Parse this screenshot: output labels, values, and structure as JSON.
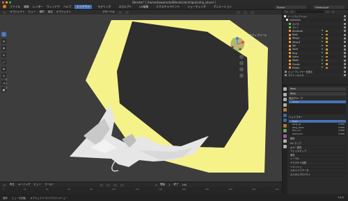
{
  "window": {
    "title": "Blender* [ /home/kawamoto/Blender/airship/airship_island ]",
    "traffic_colors": [
      "#ff5f57",
      "#febc2e",
      "#28c840"
    ]
  },
  "menubar": {
    "items": [
      "ファイル",
      "編集",
      "レンダー",
      "ウィンドウ",
      "ヘルプ"
    ],
    "workspaces": [
      "レイアウト",
      "モデリング",
      "スカルプト",
      "UV編集",
      "テクスチャペイント",
      "シェーディング",
      "アニメーション",
      "レンダリング",
      "コンポジット",
      "ジオメトリノード",
      "スクリプト"
    ],
    "active_workspace": "レイアウト",
    "scene": "Scene",
    "view_layer": "ViewLayer"
  },
  "viewport_header": {
    "mode": "オブジェクト",
    "items": [
      "ビュー",
      "選択",
      "追加",
      "オブジェクト"
    ],
    "orientation": "グローバル"
  },
  "viewport_overlay": {
    "panel_items": [
      "アクティブツール",
      "オプション",
      "トランスフォーム"
    ],
    "side_labels": [
      "X",
      "Y",
      "Z"
    ]
  },
  "toolbar": {
    "tools": [
      "select-icon",
      "cursor-icon",
      "move-icon",
      "rotate-icon",
      "scale-icon",
      "transform-icon",
      "annotate-icon",
      "measure-icon",
      "add-cube-icon"
    ]
  },
  "timeline": {
    "menus": [
      "再生",
      "キーイング",
      "ビュー",
      "マーカー"
    ],
    "frame_start_label": "開始",
    "frame_start": "1",
    "frame_end_label": "終了",
    "frame_end": "250",
    "current_frame": "1",
    "ruler": [
      "0",
      "20",
      "40",
      "60",
      "80",
      "100",
      "120",
      "140",
      "160",
      "180",
      "200",
      "220",
      "240"
    ]
  },
  "statusbar": {
    "items": [
      "選択",
      "ビューを回転",
      "オブジェクトコンテクストメニュー"
    ],
    "version": "3.6.0"
  },
  "outliner": {
    "rows": [
      {
        "name": "シーンコレクション",
        "color": "#e0e0e0"
      },
      {
        "name": "Collection",
        "color": "#e0e0e0"
      },
      {
        "name": "カメラ",
        "color": "#70c060"
      },
      {
        "name": "ライト",
        "color": "#70c060"
      },
      {
        "name": "Armature",
        "color": "#ff9a3c"
      },
      {
        "name": "Body",
        "color": "#ff9a3c"
      },
      {
        "name": "Wing.L",
        "color": "#ff9a3c"
      },
      {
        "name": "Wing.R",
        "color": "#ff9a3c"
      },
      {
        "name": "Tail",
        "color": "#ff9a3c"
      },
      {
        "name": "Head",
        "color": "#ff9a3c"
      },
      {
        "name": "Ring",
        "color": "#ff9a3c"
      },
      {
        "name": "Island",
        "color": "#ff9a3c"
      },
      {
        "name": "Water",
        "color": "#ff9a3c"
      },
      {
        "name": "Clouds",
        "color": "#ff9a3c"
      },
      {
        "name": "Empty",
        "color": "#ff9a3c"
      },
      {
        "name": "ビュープレイヤーを表示",
        "color": "#8a8a8a"
      },
      {
        "name": "ライト / カメラ",
        "color": "#8a8a8a"
      }
    ]
  },
  "properties": {
    "tab_colors": [
      "#dcdcdc",
      "#dcdcdc",
      "#dcdcdc",
      "#dcdcdc",
      "#d89b3c",
      "#4d7fc9",
      "#4d7fc9",
      "#d89b3c",
      "#7ad36d",
      "#c36fd0",
      "#dcdcdc",
      "#dcdcdc"
    ],
    "object_name": "Body",
    "data_name": "Body",
    "vertex_groups": {
      "label": "頂点グループ",
      "items": [
        "Group"
      ]
    },
    "shape_keys": {
      "label": "シェイプキー",
      "items": [
        {
          "name": "Basis",
          "value": ""
        },
        {
          "name": "wing_up",
          "value": "0.000"
        },
        {
          "name": "wing_down",
          "value": "0.000"
        },
        {
          "name": "tail_curl",
          "value": "0.000"
        },
        {
          "name": "head_turn",
          "value": "0.000"
        }
      ],
      "relative_label": "相対"
    },
    "sections": [
      "UV マップ",
      "カラー属性",
      "フェイスマップ",
      "属性",
      "ノーマル",
      "テクスチャ空間",
      "リメッシュ",
      "ジオメトリデータ",
      "カスタムプロパティ"
    ]
  }
}
